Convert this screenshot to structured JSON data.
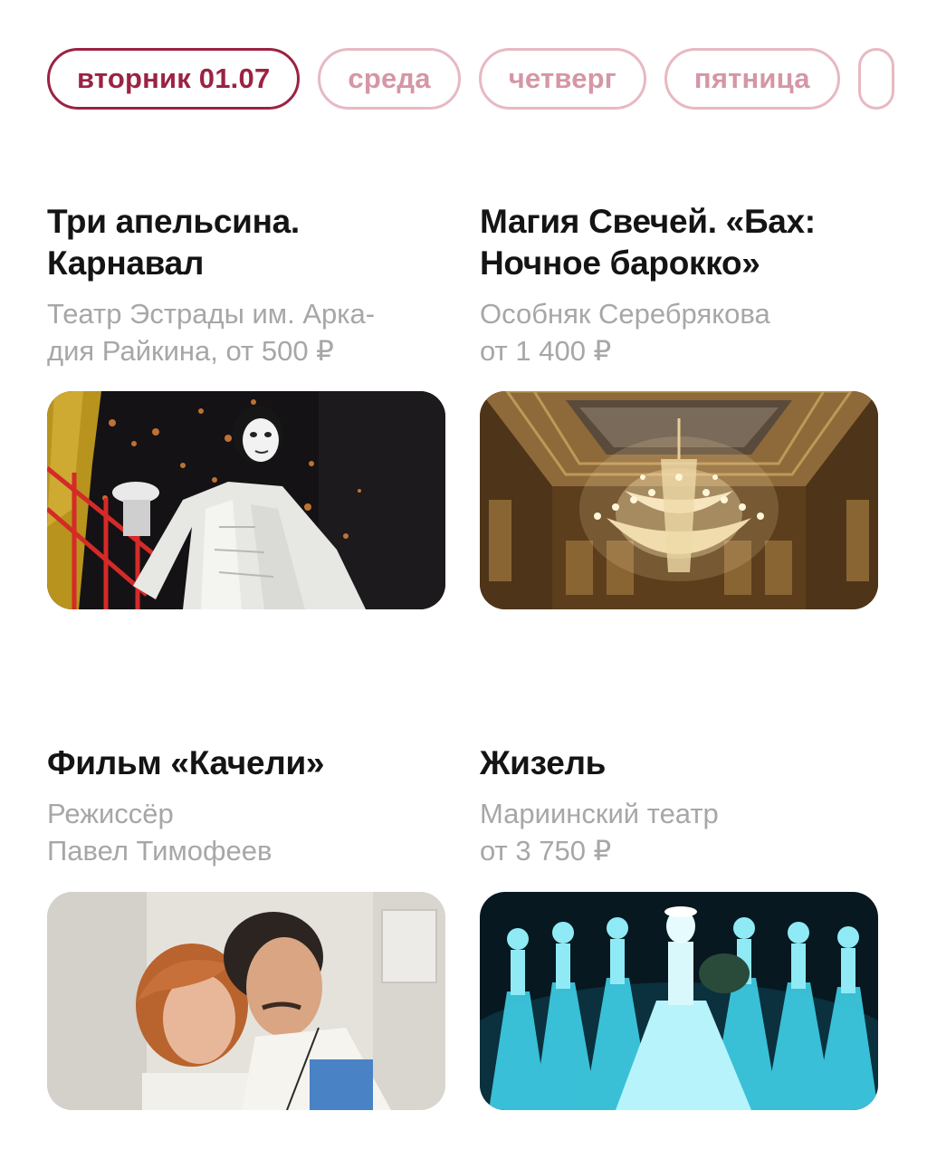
{
  "days": [
    {
      "label": "вторник 01.07",
      "active": true
    },
    {
      "label": "среда",
      "active": false
    },
    {
      "label": "четверг",
      "active": false
    },
    {
      "label": "пятница",
      "active": false
    },
    {
      "label": "",
      "active": false
    }
  ],
  "events": [
    {
      "title_lines": [
        "Три апельсина.",
        "Карнавал"
      ],
      "subtitle_lines": [
        "Театр Эстрады им. Арка-",
        "дия Райкина, от 500 ₽"
      ],
      "image_icon": "theater-performer-photo"
    },
    {
      "title_lines": [
        "Магия Свечей. «Бах:",
        "Ночное барокко»"
      ],
      "subtitle_lines": [
        "Особняк Серебрякова",
        "от 1 400 ₽"
      ],
      "image_icon": "chandelier-hall-photo"
    },
    {
      "title_lines": [
        "Фильм «Качели»"
      ],
      "subtitle_lines": [
        "Режиссёр",
        "Павел Тимофеев"
      ],
      "image_icon": "film-still-couple-photo"
    },
    {
      "title_lines": [
        "Жизель"
      ],
      "subtitle_lines": [
        "Мариинский театр",
        "от 3 750 ₽"
      ],
      "image_icon": "ballet-dancers-photo"
    }
  ],
  "colors": {
    "accent": "#9b2342",
    "chip_inactive": "#d596a6",
    "subtitle": "#a7a7a7",
    "title": "#141414"
  }
}
